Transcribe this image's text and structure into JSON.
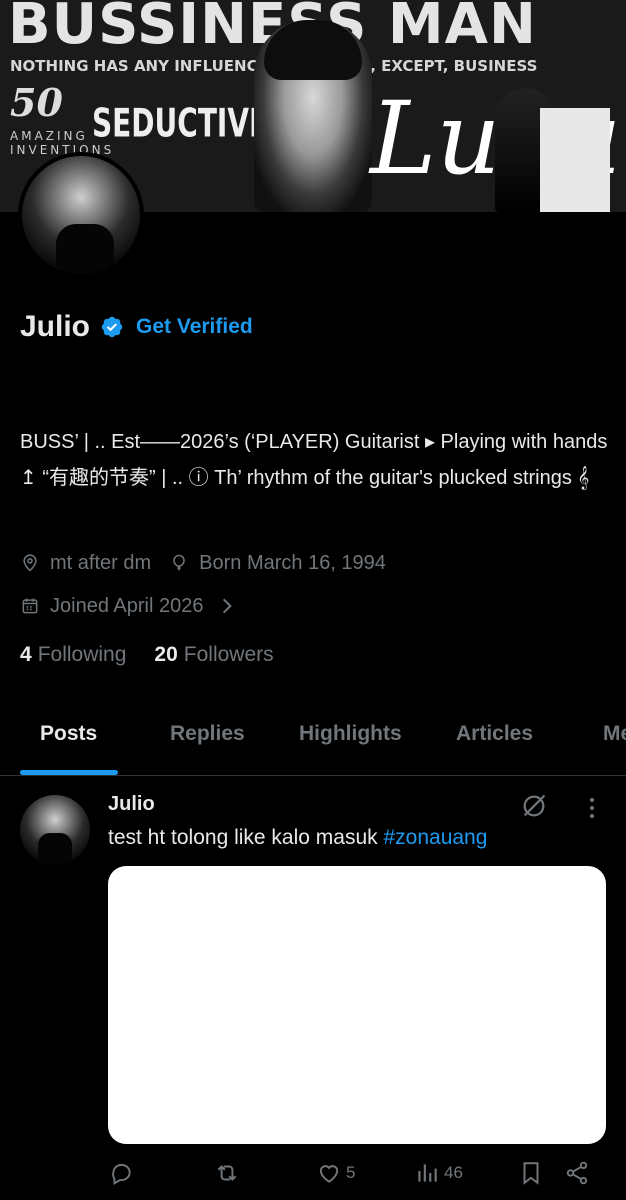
{
  "banner": {
    "title": "BUSSINESS MAN",
    "subtitle": "NOTHING HAS ANY INFLUENCE ON MY LIFE, EXCEPT, BUSINESS",
    "number": "50",
    "side_text": "AMAZING INVENTIONS",
    "mid_text": "SEDUCTIVE",
    "script_text": "Luxury"
  },
  "profile": {
    "name": "Julio",
    "get_verified": "Get Verified",
    "bio": "BUSS’ | ..  Est——2026’s (‘PLAYER) Guitarist ▸ Playing with hands ↥ “有趣的节奏” | .. ⓘ Th’ rhythm of the guitar's plucked strings 𝄞",
    "location": "mt after dm",
    "born": "Born March 16, 1994",
    "joined": "Joined April 2026",
    "following_count": "4",
    "following_label": "Following",
    "followers_count": "20",
    "followers_label": "Followers"
  },
  "tabs": [
    "Posts",
    "Replies",
    "Highlights",
    "Articles",
    "Media"
  ],
  "active_tab": "Posts",
  "post": {
    "author": "Julio",
    "text": "test ht tolong like kalo masuk ",
    "hashtag": "#zonauang",
    "likes": "5",
    "views": "46"
  },
  "colors": {
    "accent": "#1d9bf0",
    "background": "#000000",
    "muted": "#71767b",
    "text": "#e7e9ea"
  },
  "icons": [
    "verified-badge-icon",
    "location-pin-icon",
    "balloon-icon",
    "calendar-icon",
    "chevron-right-icon",
    "grok-icon",
    "more-vertical-icon",
    "reply-icon",
    "repost-icon",
    "like-icon",
    "views-icon",
    "bookmark-icon",
    "share-icon"
  ]
}
